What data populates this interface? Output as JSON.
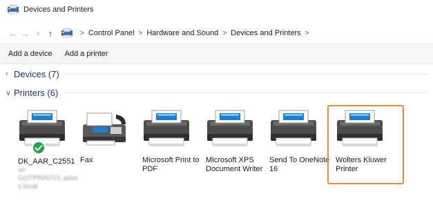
{
  "window": {
    "title": "Devices and Printers"
  },
  "address": {
    "crumbs": [
      "Control Panel",
      "Hardware and Sound",
      "Devices and Printers"
    ]
  },
  "toolbar": {
    "add_device": "Add a device",
    "add_printer": "Add a printer"
  },
  "groups": {
    "devices": {
      "title": "Devices (7)",
      "collapsed": true
    },
    "printers": {
      "title": "Printers (6)",
      "collapsed": false
    }
  },
  "printers": [
    {
      "name": "DK_AAR_C2551",
      "icon": "printer-icon",
      "default": true,
      "sub": [
        "on",
        "GOTPRINT01.adss",
        "s.local"
      ]
    },
    {
      "name": "Fax",
      "icon": "fax-icon"
    },
    {
      "name": "Microsoft Print to PDF",
      "icon": "printer-icon"
    },
    {
      "name": "Microsoft XPS Document Writer",
      "icon": "printer-icon"
    },
    {
      "name": "Send To OneNote 16",
      "icon": "printer-icon"
    },
    {
      "name": "Wolters Kluwer Printer",
      "icon": "printer-icon",
      "highlighted": true
    }
  ],
  "colors": {
    "highlight": "#e8893a",
    "group_title": "#1e3287",
    "default_check": "#1ea24a"
  }
}
